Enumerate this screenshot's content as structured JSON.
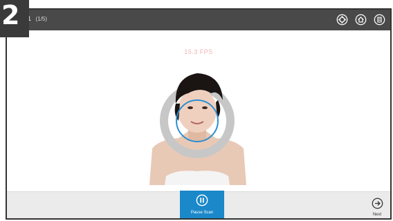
{
  "step_badge": "2",
  "header": {
    "step_number": "1",
    "step_count": "(1/5)",
    "icons": [
      "settings-icon",
      "home-icon",
      "menu-icon"
    ]
  },
  "scan": {
    "fps_text": "15.3 FPS"
  },
  "footer": {
    "pause_label": "Pause Scan",
    "next_label": "Next"
  },
  "colors": {
    "accent": "#1a88c9",
    "topbar": "#494949",
    "fps_text": "#f2b3b3"
  }
}
